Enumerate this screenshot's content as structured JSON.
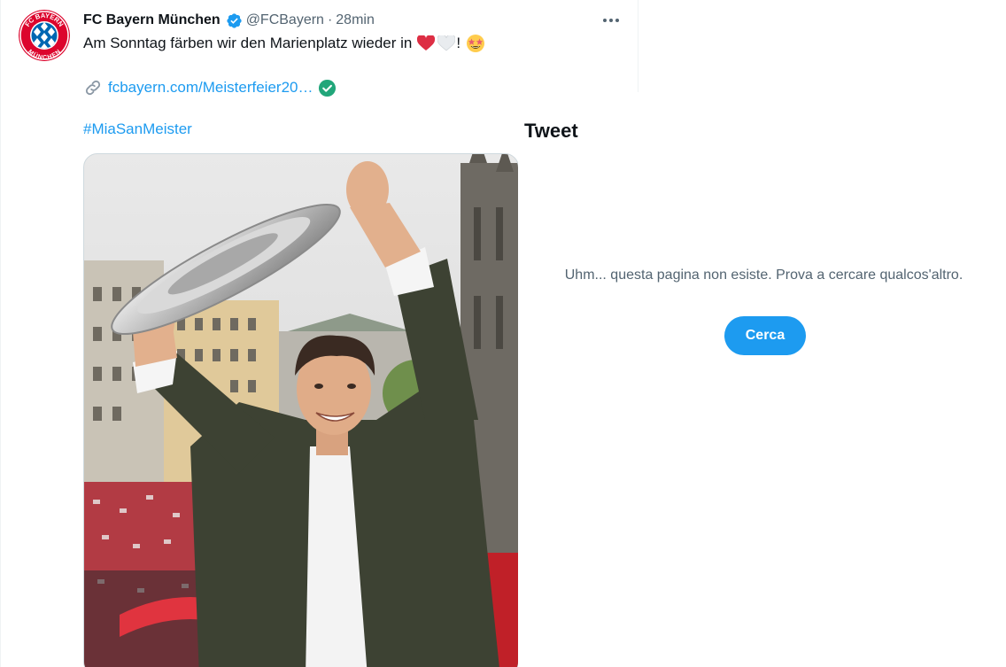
{
  "tweet": {
    "display_name": "FC Bayern München",
    "handle": "@FCBayern",
    "separator": "·",
    "time": "28min",
    "more_label": "•••",
    "text": "Am Sonntag färben wir den Marienplatz wieder in",
    "text_suffix": "!",
    "emojis": [
      "red-heart",
      "white-heart",
      "star-struck"
    ],
    "link": "fcbayern.com/Meisterfeier20…",
    "hashtag": "#MiaSanMeister",
    "avatar_logo": {
      "top_text": "FC BAYERN",
      "bottom_text": "MÜNCHEN"
    }
  },
  "overlay": {
    "title": "Tweet",
    "message": "Uhm... questa pagina non esiste. Prova a cercare qualcos'altro.",
    "button_label": "Cerca"
  },
  "colors": {
    "accent": "#1d9bf0",
    "text_primary": "#0f1419",
    "text_secondary": "#536471",
    "verified_green": "#21a67a",
    "bayern_red": "#dc052d",
    "bayern_blue": "#0066b2"
  }
}
